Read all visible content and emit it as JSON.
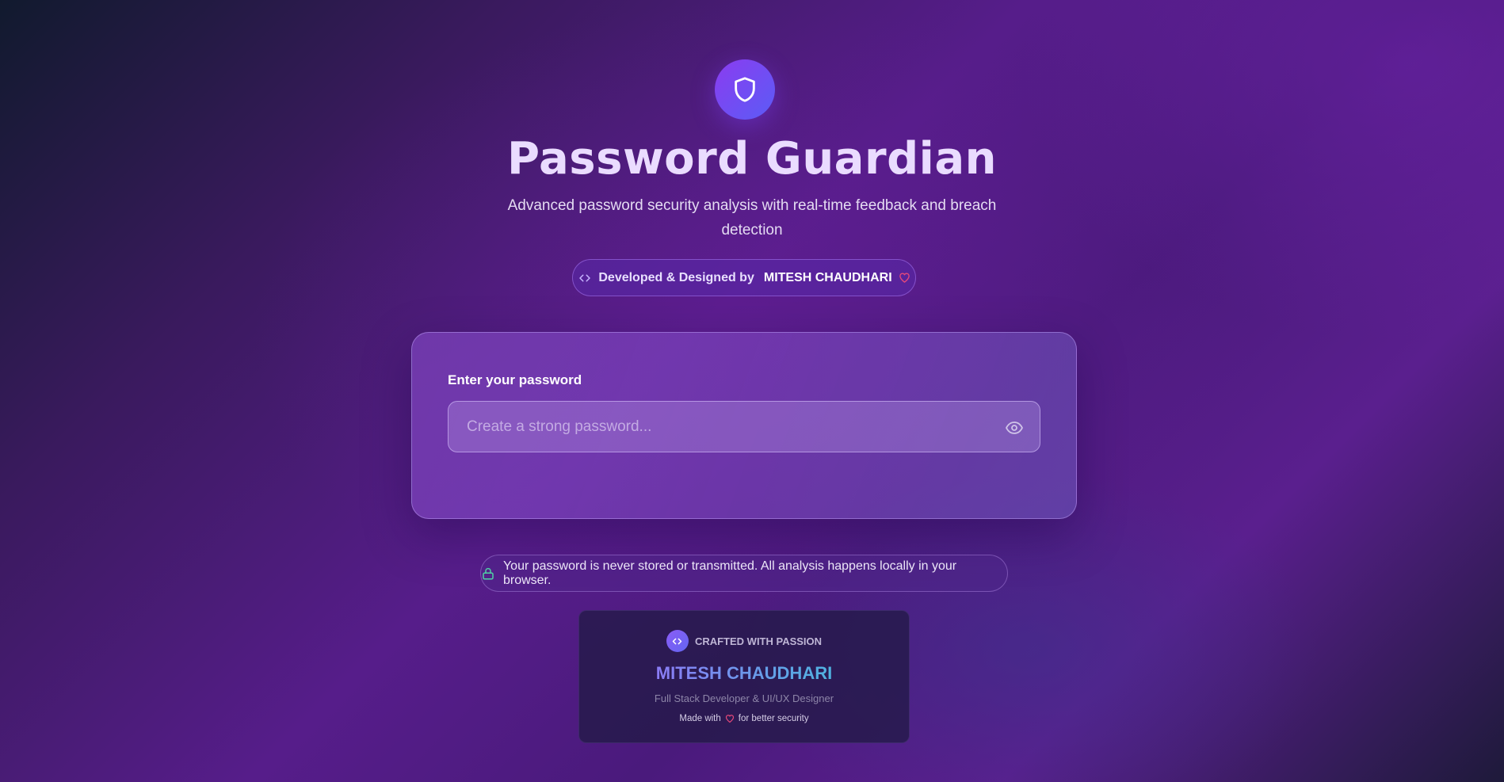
{
  "app": {
    "title": "Password Guardian",
    "subtitle": "Advanced password security analysis with real-time feedback and breach detection",
    "logo_icon": "shield-icon"
  },
  "credit_badge": {
    "prefix": "Developed & Designed by",
    "name": "MITESH CHAUDHARI",
    "code_icon": "code-icon",
    "heart_icon": "heart-icon"
  },
  "password_card": {
    "label": "Enter your password",
    "input_value": "",
    "placeholder": "Create a strong password...",
    "toggle_icon": "eye-icon"
  },
  "privacy_notice": {
    "text": "Your password is never stored or transmitted. All analysis happens locally in your browser.",
    "icon": "lock-icon"
  },
  "footer": {
    "crafted": "CRAFTED WITH PASSION",
    "name": "MITESH CHAUDHARI",
    "role": "Full Stack Developer & UI/UX Designer",
    "made_prefix": "Made with",
    "made_suffix": "for better security"
  },
  "colors": {
    "accent_purple": "#8b3cf0",
    "accent_blue": "#5b5cf6",
    "heart": "#e5487a",
    "lock": "#4fd1a5"
  }
}
